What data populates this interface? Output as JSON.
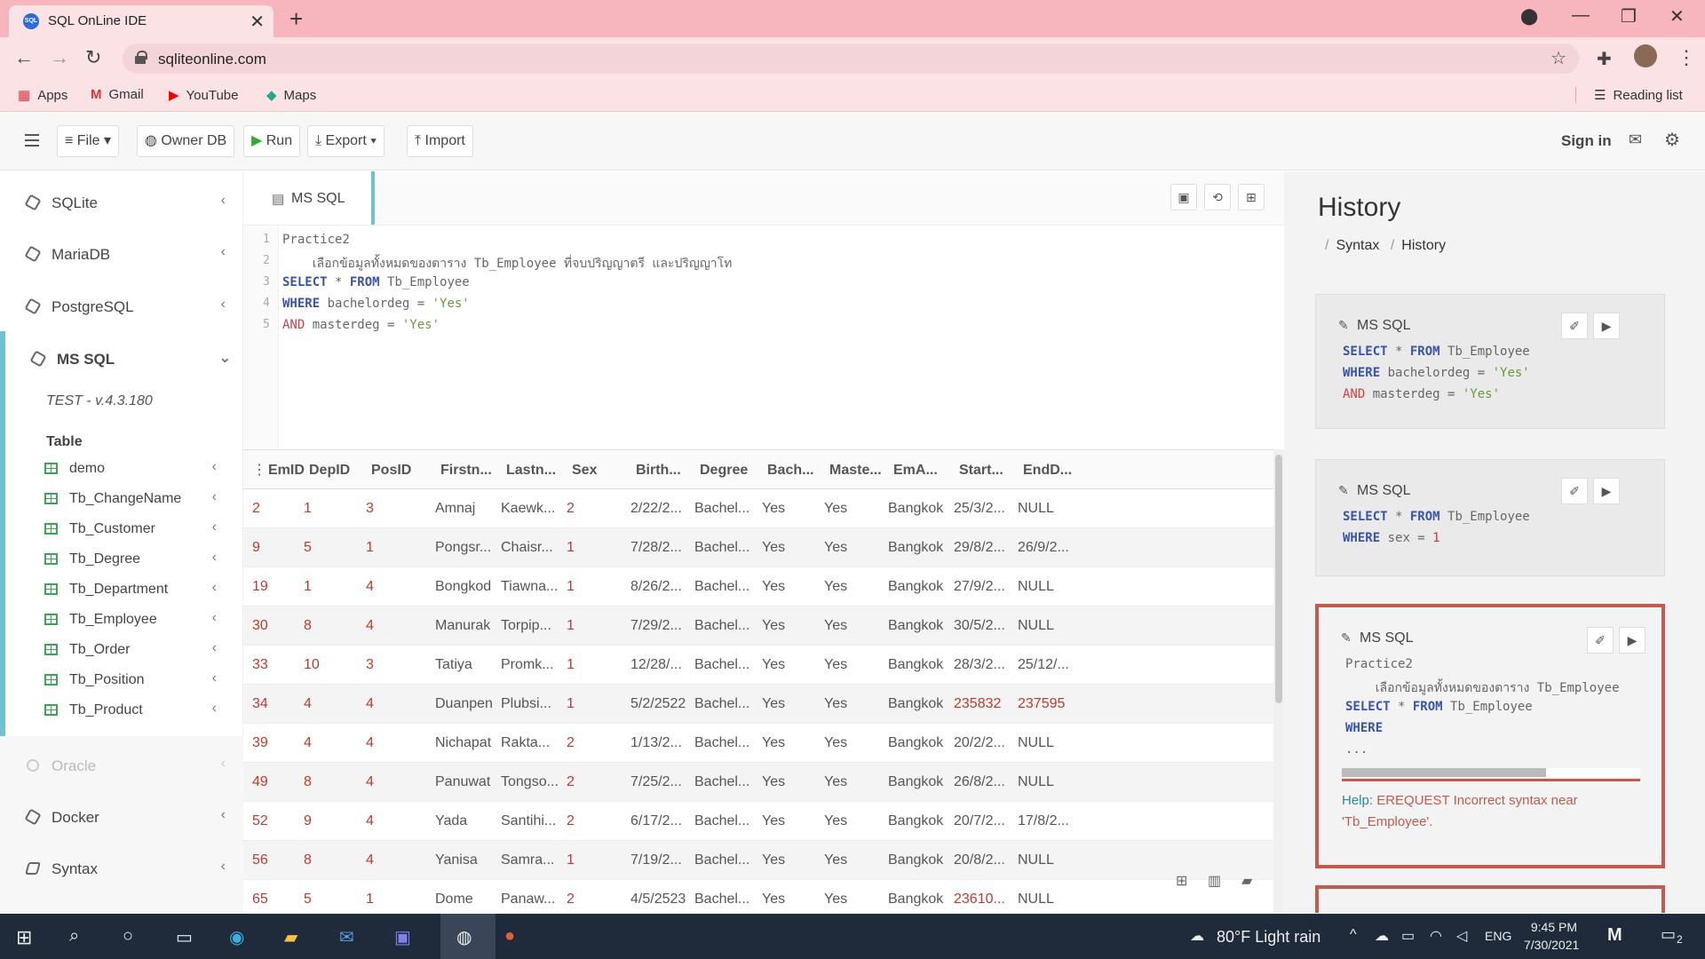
{
  "browser": {
    "tab_title": "SQL OnLine IDE",
    "tab_favicon": "SQL",
    "url": "sqliteonline.com",
    "bookmarks": [
      "Apps",
      "Gmail",
      "YouTube",
      "Maps"
    ],
    "reading_list": "Reading list"
  },
  "toolbar": {
    "file": "File",
    "owner_db": "Owner DB",
    "run": "Run",
    "export": "Export",
    "import": "Import",
    "sign_in": "Sign in"
  },
  "sidebar": {
    "dbs": [
      "SQLite",
      "MariaDB",
      "PostgreSQL"
    ],
    "active_db": "MS SQL",
    "version": "TEST - v.4.3.180",
    "table_header": "Table",
    "tables": [
      "demo",
      "Tb_ChangeName",
      "Tb_Customer",
      "Tb_Degree",
      "Tb_Department",
      "Tb_Employee",
      "Tb_Order",
      "Tb_Position",
      "Tb_Product"
    ],
    "lower_dbs": [
      "Oracle",
      "Docker",
      "Syntax"
    ]
  },
  "editor": {
    "tab_label": "MS SQL",
    "lines": [
      "Practice2",
      "    เลือกข้อมูลทั้งหมดของตาราง Tb_Employee ที่จบปริญญาตรี และปริญญาโท",
      "SELECT * FROM Tb_Employee",
      "WHERE bachelordeg = 'Yes'",
      "AND masterdeg = 'Yes'"
    ]
  },
  "results": {
    "columns": [
      "EmID",
      "DepID",
      "PosID",
      "Firstn...",
      "Lastn...",
      "Sex",
      "Birth...",
      "Degree",
      "Bach...",
      "Maste...",
      "EmA...",
      "Start...",
      "EndD..."
    ],
    "rows": [
      [
        "2",
        "1",
        "3",
        "Amnaj",
        "Kaewk...",
        "2",
        "2/22/2...",
        "Bachel...",
        "Yes",
        "Yes",
        "Bangkok",
        "25/3/2...",
        "NULL"
      ],
      [
        "9",
        "5",
        "1",
        "Pongsr...",
        "Chaisr...",
        "1",
        "7/28/2...",
        "Bachel...",
        "Yes",
        "Yes",
        "Bangkok",
        "29/8/2...",
        "26/9/2..."
      ],
      [
        "19",
        "1",
        "4",
        "Bongkod",
        "Tiawna...",
        "1",
        "8/26/2...",
        "Bachel...",
        "Yes",
        "Yes",
        "Bangkok",
        "27/9/2...",
        "NULL"
      ],
      [
        "30",
        "8",
        "4",
        "Manurak",
        "Torpip...",
        "1",
        "7/29/2...",
        "Bachel...",
        "Yes",
        "Yes",
        "Bangkok",
        "30/5/2...",
        "NULL"
      ],
      [
        "33",
        "10",
        "3",
        "Tatiya",
        "Promk...",
        "1",
        "12/28/...",
        "Bachel...",
        "Yes",
        "Yes",
        "Bangkok",
        "28/3/2...",
        "25/12/..."
      ],
      [
        "34",
        "4",
        "4",
        "Duanpen",
        "Plubsi...",
        "1",
        "5/2/2522",
        "Bachel...",
        "Yes",
        "Yes",
        "Bangkok",
        "235832",
        "237595"
      ],
      [
        "39",
        "4",
        "4",
        "Nichapat",
        "Rakta...",
        "2",
        "1/13/2...",
        "Bachel...",
        "Yes",
        "Yes",
        "Bangkok",
        "20/2/2...",
        "NULL"
      ],
      [
        "49",
        "8",
        "4",
        "Panuwat",
        "Tongso...",
        "2",
        "7/25/2...",
        "Bachel...",
        "Yes",
        "Yes",
        "Bangkok",
        "26/8/2...",
        "NULL"
      ],
      [
        "52",
        "9",
        "4",
        "Yada",
        "Santihi...",
        "2",
        "6/17/2...",
        "Bachel...",
        "Yes",
        "Yes",
        "Bangkok",
        "20/7/2...",
        "17/8/2..."
      ],
      [
        "56",
        "8",
        "4",
        "Yanisa",
        "Samra...",
        "1",
        "7/19/2...",
        "Bachel...",
        "Yes",
        "Yes",
        "Bangkok",
        "20/8/2...",
        "NULL"
      ],
      [
        "65",
        "5",
        "1",
        "Dome",
        "Panaw...",
        "2",
        "4/5/2523",
        "Bachel...",
        "Yes",
        "Yes",
        "Bangkok",
        "23610...",
        "NULL"
      ]
    ]
  },
  "history": {
    "title": "History",
    "crumbs": [
      "Syntax",
      "History"
    ],
    "cards": [
      {
        "db": "MS SQL",
        "lines": [
          "SELECT * FROM Tb_Employee",
          "WHERE bachelordeg = 'Yes'",
          "AND masterdeg = 'Yes'"
        ]
      },
      {
        "db": "MS SQL",
        "lines": [
          "SELECT * FROM Tb_Employee",
          "WHERE sex = 1"
        ]
      },
      {
        "db": "MS SQL",
        "lines": [
          "Practice2",
          "    เลือกข้อมูลทั้งหมดของตาราง Tb_Employee",
          "SELECT * FROM Tb_Employee",
          "WHERE",
          "..."
        ],
        "help_label": "Help:",
        "error": "EREQUEST Incorrect syntax near 'Tb_Employee'."
      }
    ]
  },
  "taskbar": {
    "weather": "80°F Light rain",
    "lang": "ENG",
    "time": "9:45 PM",
    "date": "7/30/2021",
    "notif": "2"
  },
  "colors": {
    "accent": "#6fc3d0",
    "error": "#c25a50",
    "chrome": "#f7b6bd"
  }
}
